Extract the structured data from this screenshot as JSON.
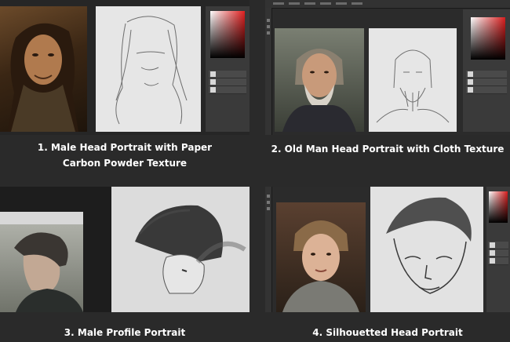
{
  "tutorials": [
    {
      "caption_line1": "1. Male Head Portrait with Paper",
      "caption_line2": "Carbon Powder Texture"
    },
    {
      "caption_line1": "2. Old Man Head Portrait with Cloth Texture"
    },
    {
      "caption_line1": "3. Male Profile Portrait"
    },
    {
      "caption_line1": "4. Silhouetted Head Portrait"
    }
  ],
  "icons": {
    "layers": "layers-icon",
    "eye": "eye-icon",
    "tool": "brush-icon"
  },
  "colors": {
    "background": "#2a2a2a",
    "panel": "#3a3a3a",
    "canvas": "#e6e6e6",
    "caption": "#ffffff"
  }
}
